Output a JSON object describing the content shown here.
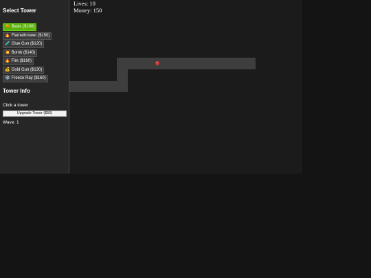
{
  "sidebar": {
    "select_heading": "Select Tower",
    "towers": [
      {
        "label": "Basic ($100)",
        "icon": "gun-icon",
        "glyph": "🔫",
        "selected": true
      },
      {
        "label": "Flamethrower ($150)",
        "icon": "fire-icon",
        "glyph": "🔥",
        "selected": false
      },
      {
        "label": "Glue Gun ($120)",
        "icon": "test-tube-icon",
        "glyph": "🧪",
        "selected": false
      },
      {
        "label": "Bomb ($140)",
        "icon": "explosion-icon",
        "glyph": "💥",
        "selected": false
      },
      {
        "label": "Fire ($160)",
        "icon": "fire-icon",
        "glyph": "🔥",
        "selected": false
      },
      {
        "label": "Gold Gun ($130)",
        "icon": "money-bag-icon",
        "glyph": "💰",
        "selected": false
      },
      {
        "label": "Freeze Ray ($160)",
        "icon": "snowflake-icon",
        "glyph": "❄️",
        "selected": false
      }
    ],
    "info_heading": "Tower Info",
    "info_text": "Click a tower",
    "upgrade_label": "Upgrade Tower ($50)",
    "wave_text": "Wave: 1"
  },
  "game": {
    "lives_text": "Lives: 10",
    "money_text": "Money: 150",
    "enemies": [
      {
        "type": "balloon",
        "color": "#e03c3c"
      }
    ]
  },
  "colors": {
    "sidebar_bg": "#262626",
    "game_bg": "#1b1b1b",
    "path": "#3e3e3e",
    "selected_accent": "#5ab00c",
    "balloon": "#e03c3c"
  }
}
